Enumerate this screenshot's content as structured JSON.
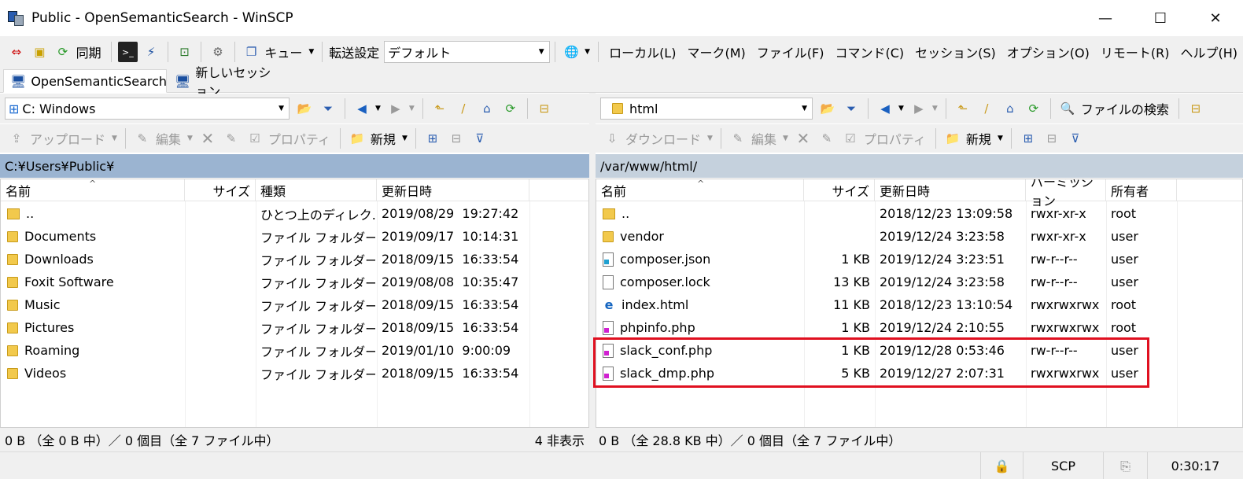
{
  "window": {
    "title": "Public - OpenSemanticSearch - WinSCP"
  },
  "toolbar": {
    "sync_label": "同期",
    "queue_label": "キュー",
    "transfer_settings_label": "転送設定",
    "transfer_preset": "デフォルト",
    "menus": [
      "ローカル(L)",
      "マーク(M)",
      "ファイル(F)",
      "コマンド(C)",
      "セッション(S)",
      "オプション(O)",
      "リモート(R)",
      "ヘルプ(H)"
    ]
  },
  "tabs": [
    {
      "label": "OpenSemanticSearch"
    },
    {
      "label": "新しいセッション"
    }
  ],
  "local": {
    "drive": "C: Windows",
    "actions": {
      "upload": "アップロード",
      "edit": "編集",
      "properties": "プロパティ",
      "new": "新規"
    },
    "path": "C:¥Users¥Public¥",
    "columns": [
      "名前",
      "サイズ",
      "種類",
      "更新日時"
    ],
    "rows": [
      {
        "name": "..",
        "size": "",
        "type": "ひとつ上のディレク...",
        "modified": "2019/08/29  19:27:42",
        "icon": "parent-dir-icon"
      },
      {
        "name": "Documents",
        "size": "",
        "type": "ファイル フォルダー",
        "modified": "2019/09/17  10:14:31",
        "icon": "folder-icon"
      },
      {
        "name": "Downloads",
        "size": "",
        "type": "ファイル フォルダー",
        "modified": "2018/09/15  16:33:54",
        "icon": "folder-icon"
      },
      {
        "name": "Foxit Software",
        "size": "",
        "type": "ファイル フォルダー",
        "modified": "2019/08/08  10:35:47",
        "icon": "folder-icon"
      },
      {
        "name": "Music",
        "size": "",
        "type": "ファイル フォルダー",
        "modified": "2018/09/15  16:33:54",
        "icon": "folder-icon"
      },
      {
        "name": "Pictures",
        "size": "",
        "type": "ファイル フォルダー",
        "modified": "2018/09/15  16:33:54",
        "icon": "folder-icon"
      },
      {
        "name": "Roaming",
        "size": "",
        "type": "ファイル フォルダー",
        "modified": "2019/01/10  9:00:09",
        "icon": "folder-icon"
      },
      {
        "name": "Videos",
        "size": "",
        "type": "ファイル フォルダー",
        "modified": "2018/09/15  16:33:54",
        "icon": "folder-icon"
      }
    ],
    "status": "0 B （全 0 B 中）／ 0 個目（全 7 ファイル中）",
    "hidden": "4 非表示"
  },
  "remote": {
    "dir": "html",
    "find_files_label": "ファイルの検索",
    "actions": {
      "download": "ダウンロード",
      "edit": "編集",
      "properties": "プロパティ",
      "new": "新規"
    },
    "path": "/var/www/html/",
    "columns": [
      "名前",
      "サイズ",
      "更新日時",
      "パーミッション",
      "所有者"
    ],
    "rows": [
      {
        "name": "..",
        "size": "",
        "modified": "2018/12/23 13:09:58",
        "perm": "rwxr-xr-x",
        "owner": "root",
        "icon": "parent-dir-icon"
      },
      {
        "name": "vendor",
        "size": "",
        "modified": "2019/12/24 3:23:58",
        "perm": "rwxr-xr-x",
        "owner": "user",
        "icon": "folder-icon"
      },
      {
        "name": "composer.json",
        "size": "1 KB",
        "modified": "2019/12/24 3:23:51",
        "perm": "rw-r--r--",
        "owner": "user",
        "icon": "json-file-icon"
      },
      {
        "name": "composer.lock",
        "size": "13 KB",
        "modified": "2019/12/24 3:23:58",
        "perm": "rw-r--r--",
        "owner": "user",
        "icon": "file-icon"
      },
      {
        "name": "index.html",
        "size": "11 KB",
        "modified": "2018/12/23 13:10:54",
        "perm": "rwxrwxrwx",
        "owner": "root",
        "icon": "html-file-icon"
      },
      {
        "name": "phpinfo.php",
        "size": "1 KB",
        "modified": "2019/12/24 2:10:55",
        "perm": "rwxrwxrwx",
        "owner": "root",
        "icon": "php-file-icon"
      },
      {
        "name": "slack_conf.php",
        "size": "1 KB",
        "modified": "2019/12/28 0:53:46",
        "perm": "rw-r--r--",
        "owner": "user",
        "icon": "php-file-icon"
      },
      {
        "name": "slack_dmp.php",
        "size": "5 KB",
        "modified": "2019/12/27 2:07:31",
        "perm": "rwxrwxrwx",
        "owner": "user",
        "icon": "php-file-icon"
      }
    ],
    "status": "0 B （全 28.8 KB 中）／ 0 個目（全 7 ファイル中）"
  },
  "statusbar": {
    "protocol": "SCP",
    "elapsed": "0:30:17"
  },
  "colors": {
    "local_path_bg": "#9bb4d1",
    "remote_path_bg": "#c5d1dd",
    "highlight": "#e01020"
  }
}
